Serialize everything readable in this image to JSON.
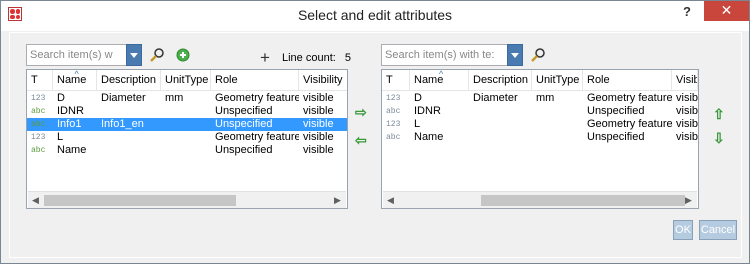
{
  "window": {
    "title": "Select and edit attributes",
    "help": "?",
    "close": "✕"
  },
  "left": {
    "search_placeholder": "Search item(s) w",
    "line_count_label": "Line count:",
    "line_count": "5",
    "columns": [
      "T",
      "Name",
      "Description",
      "UnitType",
      "Role",
      "Visibility"
    ],
    "rows": [
      {
        "t": "123",
        "name": "D",
        "description": "Diameter",
        "unittype": "mm",
        "role": "Geometry feature",
        "visibility": "visible",
        "selected": false
      },
      {
        "t": "abc",
        "name": "IDNR",
        "description": "",
        "unittype": "",
        "role": "Unspecified",
        "visibility": "visible",
        "selected": false
      },
      {
        "t": "abc",
        "name": "Info1",
        "description": "Info1_en",
        "unittype": "",
        "role": "Unspecified",
        "visibility": "visible",
        "selected": true
      },
      {
        "t": "123",
        "name": "L",
        "description": "",
        "unittype": "",
        "role": "Geometry feature",
        "visibility": "visible",
        "selected": false
      },
      {
        "t": "abc",
        "name": "Name",
        "description": "",
        "unittype": "",
        "role": "Unspecified",
        "visibility": "visible",
        "selected": false
      }
    ]
  },
  "right": {
    "search_placeholder": "Search item(s) with te:",
    "columns": [
      "T",
      "Name",
      "Description",
      "UnitType",
      "Role",
      "Visibi"
    ],
    "rows": [
      {
        "t": "123",
        "name": "D",
        "description": "Diameter",
        "unittype": "mm",
        "role": "Geometry feature",
        "visibility": "visibl"
      },
      {
        "t": "abc",
        "name": "IDNR",
        "description": "",
        "unittype": "",
        "role": "Unspecified",
        "visibility": "visibl"
      },
      {
        "t": "123",
        "name": "L",
        "description": "",
        "unittype": "",
        "role": "Geometry feature",
        "visibility": "visibl"
      },
      {
        "t": "abc",
        "name": "Name",
        "description": "",
        "unittype": "",
        "role": "Unspecified",
        "visibility": "visibl"
      }
    ]
  },
  "buttons": {
    "ok": "OK",
    "cancel": "Cancel"
  },
  "arrows": {
    "move_right": "⇨",
    "move_left": "⇦",
    "move_up": "⇧",
    "move_down": "⇩",
    "add": "+"
  }
}
